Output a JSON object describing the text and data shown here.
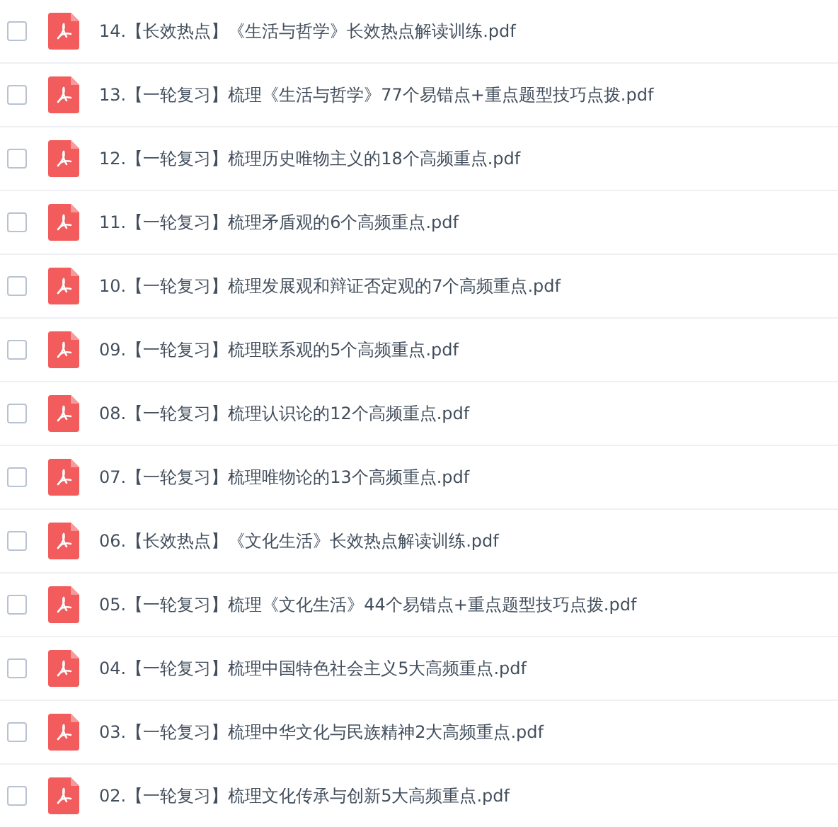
{
  "files": [
    {
      "name": "14.【长效热点】《生活与哲学》长效热点解读训练.pdf",
      "checked": false
    },
    {
      "name": "13.【一轮复习】梳理《生活与哲学》77个易错点+重点题型技巧点拨.pdf",
      "checked": false
    },
    {
      "name": "12.【一轮复习】梳理历史唯物主义的18个高频重点.pdf",
      "checked": false
    },
    {
      "name": "11.【一轮复习】梳理矛盾观的6个高频重点.pdf",
      "checked": false
    },
    {
      "name": "10.【一轮复习】梳理发展观和辩证否定观的7个高频重点.pdf",
      "checked": false
    },
    {
      "name": "09.【一轮复习】梳理联系观的5个高频重点.pdf",
      "checked": false
    },
    {
      "name": "08.【一轮复习】梳理认识论的12个高频重点.pdf",
      "checked": false
    },
    {
      "name": "07.【一轮复习】梳理唯物论的13个高频重点.pdf",
      "checked": false
    },
    {
      "name": "06.【长效热点】《文化生活》长效热点解读训练.pdf",
      "checked": false
    },
    {
      "name": "05.【一轮复习】梳理《文化生活》44个易错点+重点题型技巧点拨.pdf",
      "checked": false
    },
    {
      "name": "04.【一轮复习】梳理中国特色社会主义5大高频重点.pdf",
      "checked": false
    },
    {
      "name": "03.【一轮复习】梳理中华文化与民族精神2大高频重点.pdf",
      "checked": false
    },
    {
      "name": "02.【一轮复习】梳理文化传承与创新5大高频重点.pdf",
      "checked": false
    }
  ]
}
